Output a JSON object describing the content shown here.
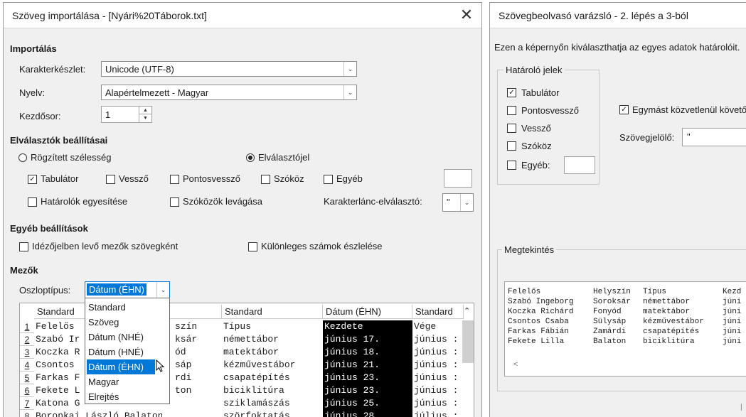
{
  "left_dialog": {
    "title": "Szöveg importálása - [Nyári%20Táborok.txt]",
    "close_glyph": "✕",
    "import": {
      "heading": "Importálás",
      "charset_label": "Karakterkészlet:",
      "charset_value": "Unicode (UTF-8)",
      "language_label": "Nyelv:",
      "language_value": "Alapértelmezett - Magyar",
      "start_row_label": "Kezdősor:",
      "start_row_value": "1"
    },
    "separators": {
      "heading": "Elválasztók beállításai",
      "fixed_width": "Rögzített szélesség",
      "separated_by": "Elválasztójel",
      "tab": "Tabulátor",
      "comma": "Vessző",
      "semicolon": "Pontosvessző",
      "space": "Szóköz",
      "other": "Egyéb",
      "merge": "Határolók egyesítése",
      "trim": "Szóközök levágása",
      "string_delim_label": "Karakterlánc-elválasztó:",
      "string_delim_value": "\""
    },
    "other_options": {
      "heading": "Egyéb beállítások",
      "quoted_as_text": "Idézőjelben levő mezők szövegként",
      "detect_special": "Különleges számok észlelése"
    },
    "fields": {
      "heading": "Mezők",
      "column_type_label": "Oszloptípus:",
      "column_type_value": "Dátum (ÉHN)",
      "dropdown_options": [
        "Standard",
        "Szöveg",
        "Dátum (NHÉ)",
        "Dátum (HNÉ)",
        "Dátum (ÉHN)",
        "Magyar",
        "Elrejtés"
      ],
      "dropdown_selected": "Dátum (ÉHN)",
      "headers": [
        "Standard",
        "Standard",
        "Standard",
        "Dátum (ÉHN)",
        "Standard"
      ],
      "rows": [
        {
          "n": "1",
          "c1": "Felelős",
          "c2": "szín",
          "c3": "Típus",
          "c4": "Kezdete",
          "c5": "Vége"
        },
        {
          "n": "2",
          "c1": "Szabó Ir",
          "c2": "ksár",
          "c3": "némettábor",
          "c4": "június 17.",
          "c5": "június :"
        },
        {
          "n": "3",
          "c1": "Koczka R",
          "c2": "ód",
          "c3": "matektábor",
          "c4": "június 18.",
          "c5": "június :"
        },
        {
          "n": "4",
          "c1": "Csontos",
          "c2": "sáp",
          "c3": "kézművestábor",
          "c4": "június 21.",
          "c5": "június :"
        },
        {
          "n": "5",
          "c1": "Farkas F",
          "c2": "rdi",
          "c3": "csapatépítés",
          "c4": "június 23.",
          "c5": "június :"
        },
        {
          "n": "6",
          "c1": "Fekete L",
          "c2": "ton",
          "c3": "biciklitúra",
          "c4": "június 23.",
          "c5": "június :"
        },
        {
          "n": "7",
          "c1": "Katona G",
          "c2": "",
          "c3": "sziklamászás",
          "c4": "június 25.",
          "c5": "június :"
        },
        {
          "n": "8",
          "c1": "Boronkai László Balaton",
          "c2": "",
          "c3": "szörfoktatás",
          "c4": "június 28.",
          "c5": "július :"
        }
      ]
    }
  },
  "right_dialog": {
    "title": "Szövegbeolvasó varázsló - 2. lépés a 3-ból",
    "intro": "Ezen a képernyőn kiválaszthatja az egyes adatok határolóit.",
    "delimiters_legend": "Határoló jelek",
    "tab": "Tabulátor",
    "semicolon": "Pontosvessző",
    "comma": "Vessző",
    "space": "Szóköz",
    "other": "Egyéb:",
    "consecutive": "Egymást közvetlenül követő",
    "text_qualifier_label": "Szövegjelölő:",
    "text_qualifier_value": "\"",
    "preview_legend": "Megtekintés",
    "preview_rows": [
      [
        "Felelős",
        "Helyszín",
        "Típus",
        "Kezd"
      ],
      [
        "Szabó Ingeborg",
        "Soroksár",
        "némettábor",
        "júni"
      ],
      [
        "Koczka Richárd",
        "Fonyód",
        "matektábor",
        "júni"
      ],
      [
        "Csontos Csaba",
        "Sülysáp",
        "kézművestábor",
        "júni"
      ],
      [
        "Farkas Fábián",
        "Zamárdi",
        "csapatépítés",
        "júni"
      ],
      [
        "Fekete Lilla",
        "Balaton",
        "biciklitúra",
        "júni"
      ]
    ],
    "scroll_left": "<",
    "footer_mark": "l"
  }
}
